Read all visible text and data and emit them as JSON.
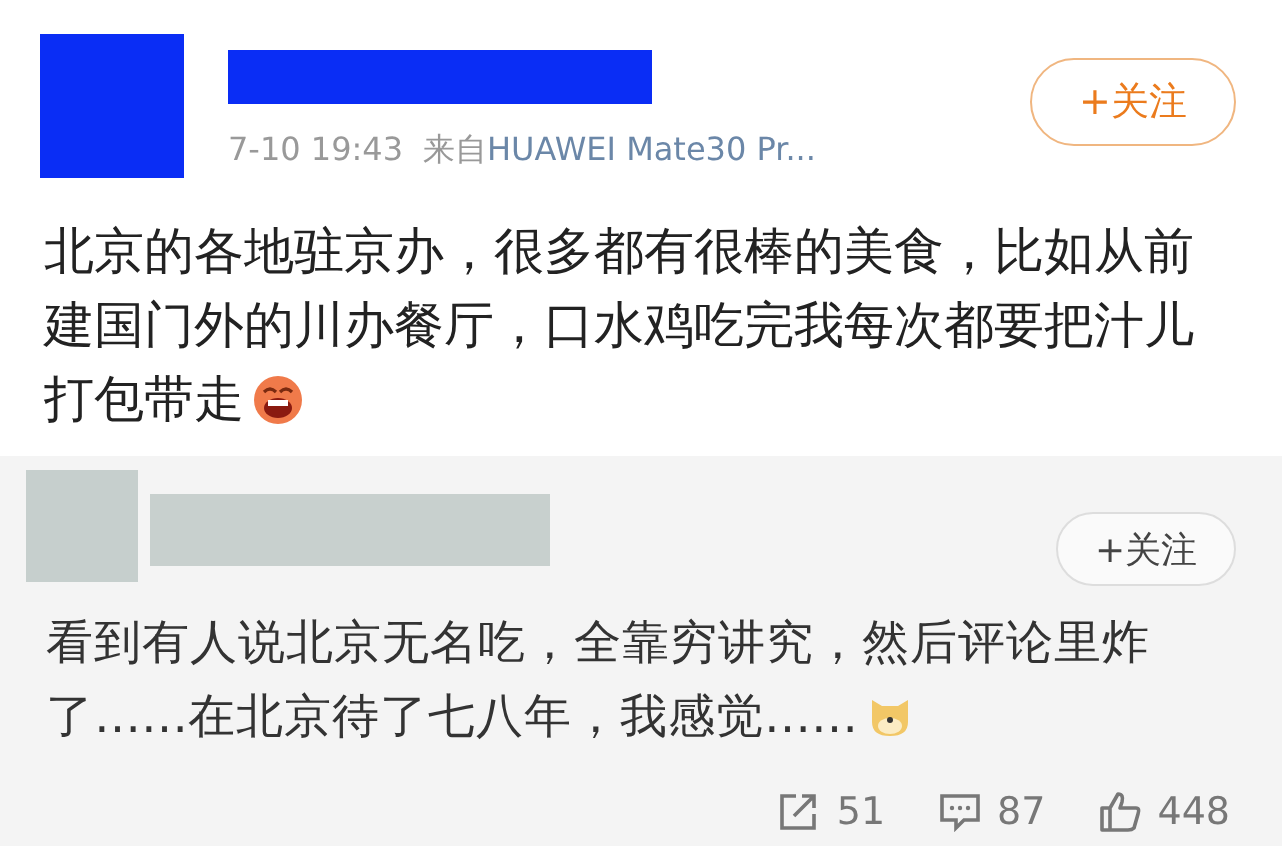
{
  "post": {
    "follow_button": "+关注",
    "time": "7-10 19:43",
    "source_prefix": "来自",
    "source": "HUAWEI Mate30 Pr...",
    "text_lines": [
      "北京的各地驻京办，很多都有很棒的美食，比如从前",
      "建国门外的川办餐厅，口水鸡吃完我每次都要把汁儿",
      "打包带走"
    ]
  },
  "comment": {
    "follow_button": "+关注",
    "text_lines": [
      "看到有人说北京无名吃，全靠穷讲究，然后评论里炸",
      "了……在北京待了七八年，我感觉……"
    ],
    "reposts": "51",
    "comments": "87",
    "likes": "448"
  }
}
